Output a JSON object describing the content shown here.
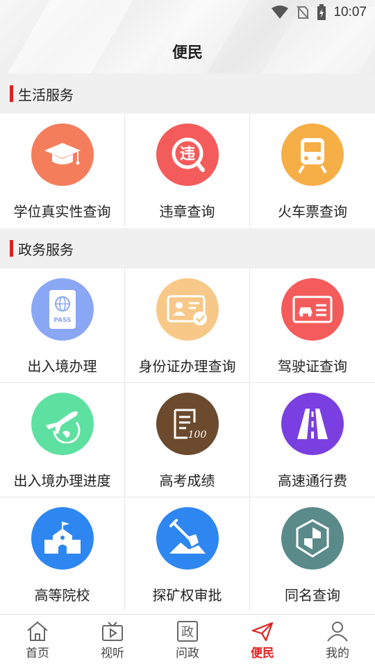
{
  "status_bar": {
    "time": "10:07"
  },
  "header": {
    "title": "便民"
  },
  "sections": [
    {
      "title": "生活服务",
      "items": [
        {
          "label": "学位真实性查询",
          "icon": "graduation-cap-icon",
          "color": "#f47e5c"
        },
        {
          "label": "违章查询",
          "icon": "violation-magnifier-icon",
          "color": "#f45c5c"
        },
        {
          "label": "火车票查询",
          "icon": "train-icon",
          "color": "#f6ae47"
        }
      ]
    },
    {
      "title": "政务服务",
      "items": [
        {
          "label": "出入境办理",
          "icon": "passport-icon",
          "color": "#8aa7f5"
        },
        {
          "label": "身份证办理查询",
          "icon": "id-card-icon",
          "color": "#f7c888"
        },
        {
          "label": "驾驶证查询",
          "icon": "driver-license-icon",
          "color": "#f45c5c"
        },
        {
          "label": "出入境办理进度",
          "icon": "airplane-globe-icon",
          "color": "#5ee0a0"
        },
        {
          "label": "高考成绩",
          "icon": "exam-score-icon",
          "color": "#6b4a2e"
        },
        {
          "label": "高速通行费",
          "icon": "highway-icon",
          "color": "#7a3fe0"
        },
        {
          "label": "高等院校",
          "icon": "school-building-icon",
          "color": "#2e86f0"
        },
        {
          "label": "探矿权审批",
          "icon": "shovel-mining-icon",
          "color": "#2e86f0"
        },
        {
          "label": "同名查询",
          "icon": "shield-hexagon-icon",
          "color": "#5a8a8a"
        }
      ]
    }
  ],
  "bottom_nav": {
    "active_color": "#e02020",
    "items": [
      {
        "label": "首页",
        "icon": "home-icon"
      },
      {
        "label": "视听",
        "icon": "tv-play-icon"
      },
      {
        "label": "问政",
        "icon": "zheng-char-icon",
        "glyph": "政"
      },
      {
        "label": "便民",
        "icon": "paper-plane-icon"
      },
      {
        "label": "我的",
        "icon": "person-icon"
      }
    ]
  }
}
